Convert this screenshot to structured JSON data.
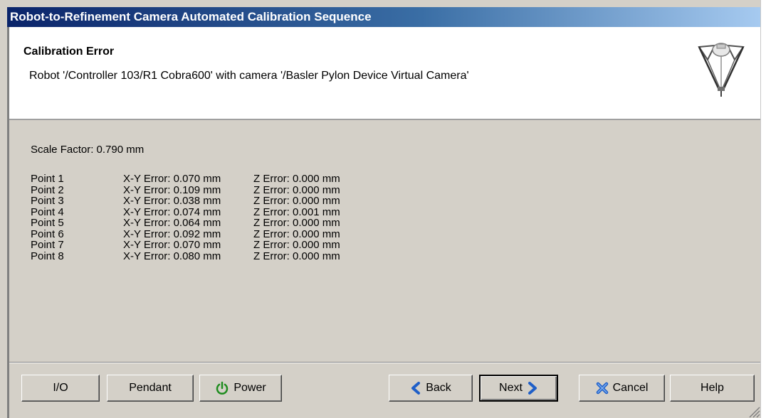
{
  "window": {
    "title": "Robot-to-Refinement Camera Automated Calibration Sequence"
  },
  "header": {
    "title": "Calibration Error",
    "subtitle": "Robot '/Controller 103/R1 Cobra600' with camera '/Basler Pylon Device Virtual Camera'",
    "icon": "delta-robot-icon"
  },
  "content": {
    "scale_factor": "Scale Factor: 0.790 mm",
    "points": [
      {
        "name": "Point 1",
        "xy_error": "X-Y Error: 0.070 mm",
        "z_error": "Z Error: 0.000 mm"
      },
      {
        "name": "Point 2",
        "xy_error": "X-Y Error: 0.109 mm",
        "z_error": "Z Error: 0.000 mm"
      },
      {
        "name": "Point 3",
        "xy_error": "X-Y Error: 0.038 mm",
        "z_error": "Z Error: 0.000 mm"
      },
      {
        "name": "Point 4",
        "xy_error": "X-Y Error: 0.074 mm",
        "z_error": "Z Error: 0.001 mm"
      },
      {
        "name": "Point 5",
        "xy_error": "X-Y Error: 0.064 mm",
        "z_error": "Z Error: 0.000 mm"
      },
      {
        "name": "Point 6",
        "xy_error": "X-Y Error: 0.092 mm",
        "z_error": "Z Error: 0.000 mm"
      },
      {
        "name": "Point 7",
        "xy_error": "X-Y Error: 0.070 mm",
        "z_error": "Z Error: 0.000 mm"
      },
      {
        "name": "Point 8",
        "xy_error": "X-Y Error: 0.080 mm",
        "z_error": "Z Error: 0.000 mm"
      }
    ]
  },
  "buttons": {
    "io": "I/O",
    "pendant": "Pendant",
    "power": "Power",
    "back": "Back",
    "next": "Next",
    "cancel": "Cancel",
    "help": "Help"
  },
  "icons": {
    "power": "power-icon",
    "back": "back-arrow-icon",
    "next": "next-arrow-icon",
    "cancel": "cancel-x-icon"
  },
  "colors": {
    "title_bar_start": "#0a246a",
    "title_bar_end": "#a6caf0",
    "dialog_face": "#d4d0c8",
    "power_icon": "#1e8c1e",
    "arrow_icon": "#1f5fc8"
  }
}
